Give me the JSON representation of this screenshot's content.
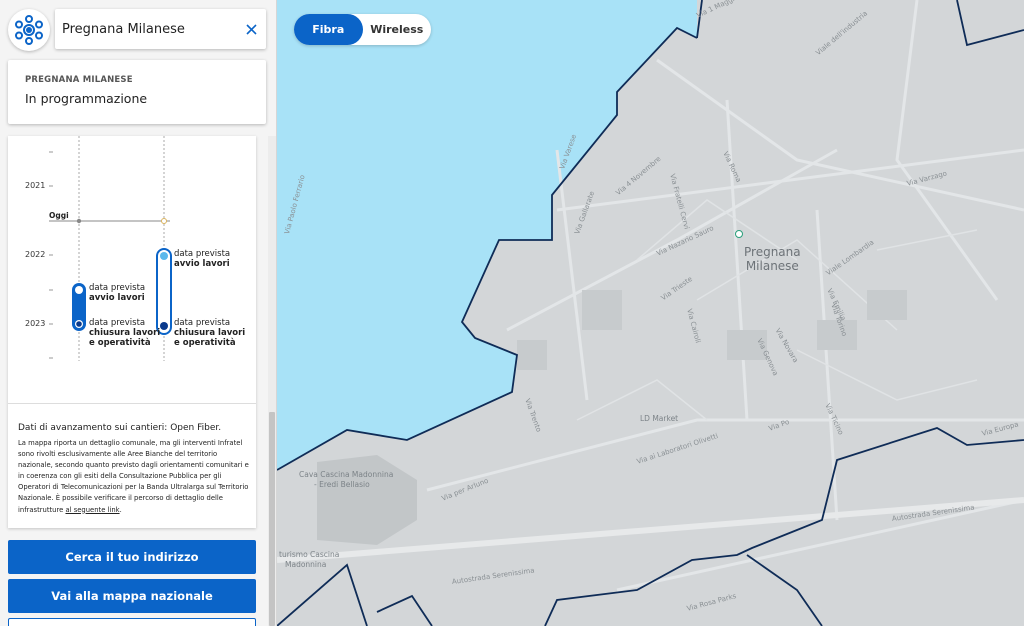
{
  "search": {
    "value": "Pregnana Milanese",
    "clear_icon": "close-icon"
  },
  "logo": {
    "icon": "network-logo-icon",
    "color": "#0b64c8"
  },
  "info_card": {
    "municipality": "PREGNANA MILANESE",
    "status": "In programmazione"
  },
  "timeline": {
    "years": [
      "2021",
      "2022",
      "2023"
    ],
    "today_label": "Oggi",
    "fibra": {
      "start_label": "data prevista",
      "start_bold": "avvio lavori",
      "end_label": "data prevista",
      "end_bold_1": "chiusura lavori",
      "end_bold_2": "e operatività"
    },
    "wireless": {
      "start_label": "data prevista",
      "start_bold": "avvio lavori",
      "end_label": "data prevista",
      "end_bold_1": "chiusura lavori",
      "end_bold_2": "e operatività"
    }
  },
  "disclaimer": {
    "source": "Dati di avanzamento sui cantieri: Open Fiber.",
    "body": "La mappa riporta un dettaglio comunale, ma gli interventi Infratel sono rivolti esclusivamente alle Aree Bianche del territorio nazionale, secondo quanto previsto dagli orientamenti comunitari e in coerenza con gli esiti della Consultazione Pubblica per gli Operatori di Telecomunicazioni per la Banda Ultralarga sul Territorio Nazionale. È possibile verificare il percorso di dettaglio delle infrastrutture ",
    "link": "al seguente link",
    "end": "."
  },
  "buttons": {
    "search_address": "Cerca il tuo indirizzo",
    "national_map": "Vai alla mappa nazionale"
  },
  "toggle": {
    "fibra": "Fibra",
    "wireless": "Wireless",
    "active": "Fibra"
  },
  "map": {
    "town": {
      "line1": "Pregnana",
      "line2": "Milanese"
    },
    "places": {
      "ld_market": "LD Market",
      "cava_1": "Cava Cascina Madonnina",
      "cava_2": "- Eredi Bellasio",
      "agri_1": "turismo Cascina",
      "agri_2": "Madonnina"
    },
    "streets": [
      "Via 1 Maggio",
      "Viale dell'industria",
      "Via Paolo Ferrario",
      "Via Varese",
      "Via Varzago",
      "Via Roma",
      "Via 4 Novembre",
      "Via Fratelli Cervi",
      "Via Gallarate",
      "Via Nazario Sauro",
      "Via Trieste",
      "Via Cairoli",
      "Viale Lombardia",
      "Via Emilia",
      "Via Novara",
      "Via Genova",
      "Via Torino",
      "Via Trento",
      "Via Po",
      "Via Ticino",
      "Via ai Laboratori Olivetti",
      "Via per Arluno",
      "Autostrada Serenissima",
      "Via Europa",
      "Via Rosa Parks"
    ],
    "colors": {
      "water": "#a8e2f7",
      "land": "#d3d6d8",
      "border": "#0f2c57"
    }
  },
  "colors": {
    "primary": "#0b64c8",
    "dark_blue": "#0a3a8c",
    "light_blue": "#5ab8ec"
  }
}
